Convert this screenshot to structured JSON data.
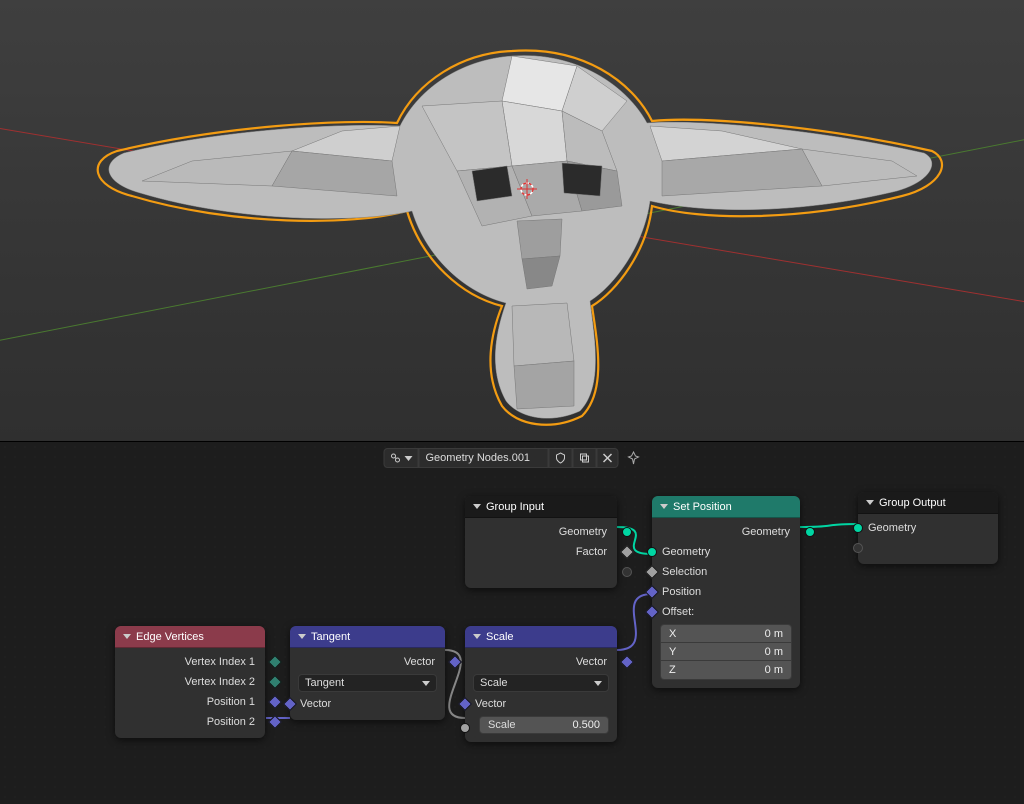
{
  "viewport": {
    "selected_object": "low-poly-creature-head"
  },
  "header": {
    "browse_tooltip": "Browse Node Tree",
    "tree_name": "Geometry Nodes.001"
  },
  "nodes": {
    "edge_vertices": {
      "title": "Edge Vertices",
      "outputs": {
        "vi1": "Vertex Index 1",
        "vi2": "Vertex Index 2",
        "p1": "Position 1",
        "p2": "Position 2"
      }
    },
    "tangent": {
      "title": "Tangent",
      "out_vector": "Vector",
      "dropdown": "Tangent",
      "in_vector": "Vector"
    },
    "scale": {
      "title": "Scale",
      "out_vector": "Vector",
      "dropdown": "Scale",
      "in_vector": "Vector",
      "scale_label": "Scale",
      "scale_value": "0.500"
    },
    "group_input": {
      "title": "Group Input",
      "geometry": "Geometry",
      "factor": "Factor"
    },
    "set_position": {
      "title": "Set Position",
      "out_geometry": "Geometry",
      "in_geometry": "Geometry",
      "selection": "Selection",
      "position": "Position",
      "offset": "Offset:",
      "x_label": "X",
      "x_val": "0 m",
      "y_label": "Y",
      "y_val": "0 m",
      "z_label": "Z",
      "z_val": "0 m"
    },
    "group_output": {
      "title": "Group Output",
      "geometry": "Geometry"
    }
  },
  "colors": {
    "geom": "#00d6a3",
    "vector": "#6363c7",
    "factor": "#a1a1a1",
    "int": "#308070"
  }
}
